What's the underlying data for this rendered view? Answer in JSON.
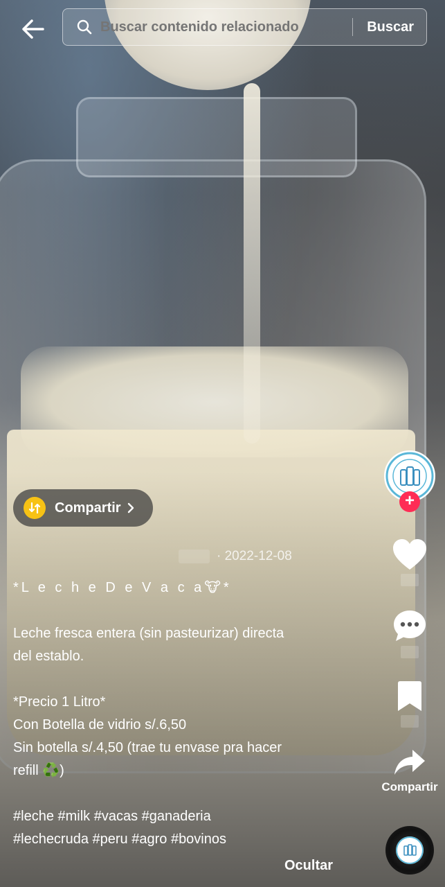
{
  "search": {
    "placeholder": "Buscar contenido relacionado",
    "button_label": "Buscar"
  },
  "share_pill": {
    "label": "Compartir"
  },
  "post": {
    "date": "· 2022-12-08",
    "caption_lines": {
      "title": "*L e c h e  D e  V a c a🐮*",
      "description_1": "Leche fresca entera (sin pasteurizar) directa",
      "description_2": "del establo.",
      "price_header": "*Precio 1 Litro*",
      "price_with_bottle": "Con Botella de vidrio s/.6,50",
      "price_without_bottle_1": "Sin botella s/.4,50 (trae tu envase pra hacer",
      "price_without_bottle_2": "refill ♻️)",
      "hashtags_1": "#leche #milk #vacas #ganaderia",
      "hashtags_2": "#lechecruda #peru #agro #bovinos"
    },
    "hide_label": "Ocultar"
  },
  "rail": {
    "follow_symbol": "+",
    "share_label": "Compartir"
  },
  "icons": [
    "back-arrow-icon",
    "search-icon",
    "heart-icon",
    "comment-icon",
    "bookmark-icon",
    "share-arrow-icon",
    "repost-icon",
    "chevron-right-icon",
    "music-disc-icon"
  ],
  "colors": {
    "follow_plus": "#fe2c55",
    "share_pill_icon": "#f7c215"
  }
}
